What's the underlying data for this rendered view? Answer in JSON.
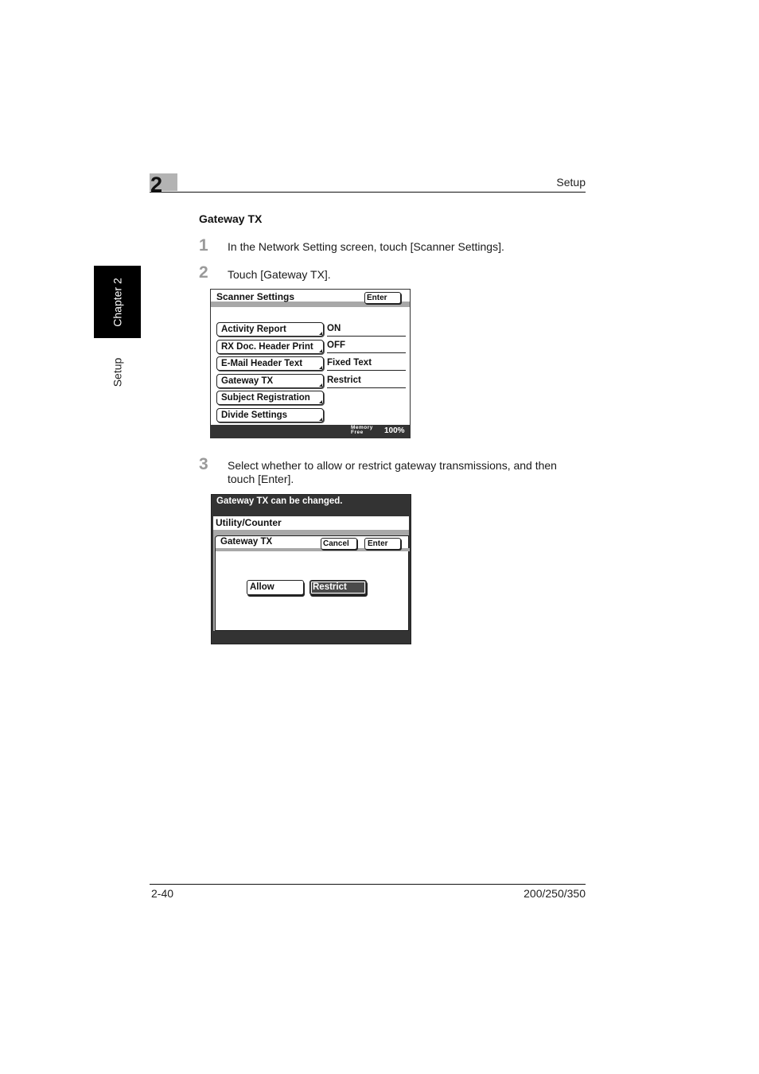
{
  "header": {
    "chapter_number": "2",
    "section_name": "Setup"
  },
  "side_tab": {
    "chapter_label": "Chapter 2",
    "section_label": "Setup"
  },
  "section_title": "Gateway TX",
  "steps": [
    {
      "number": "1",
      "text": "In the Network Setting screen, touch [Scanner Settings]."
    },
    {
      "number": "2",
      "text": "Touch [Gateway TX]."
    },
    {
      "number": "3",
      "text": "Select whether to allow or restrict gateway transmissions, and then touch [Enter]."
    }
  ],
  "scanner_settings_screen": {
    "title": "Scanner Settings",
    "enter_label": "Enter",
    "items": [
      {
        "label": "Activity Report",
        "value": "ON"
      },
      {
        "label": "RX Doc. Header Print",
        "value": "OFF"
      },
      {
        "label": "E-Mail Header Text",
        "value": "Fixed Text"
      },
      {
        "label": "Gateway TX",
        "value": "Restrict"
      },
      {
        "label": "Subject Registration",
        "value": ""
      },
      {
        "label": "Divide Settings",
        "value": ""
      }
    ],
    "memory_label_line1": "Memory",
    "memory_label_line2": "Free",
    "memory_value": "100%"
  },
  "gateway_tx_screen": {
    "message": "Gateway TX can be changed.",
    "breadcrumb": "Utility/Counter",
    "title": "Gateway TX",
    "cancel_label": "Cancel",
    "enter_label": "Enter",
    "options": [
      {
        "label": "Allow",
        "selected": false
      },
      {
        "label": "Restrict",
        "selected": true
      }
    ]
  },
  "footer": {
    "page_number": "2-40",
    "model": "200/250/350"
  }
}
